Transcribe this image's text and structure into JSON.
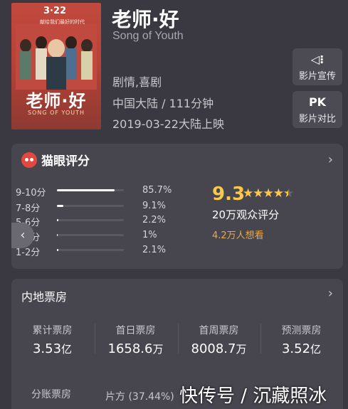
{
  "movie": {
    "title": "老师·好",
    "subtitle": "Song of Youth",
    "genre": "剧情,喜剧",
    "region_duration": "中国大陆 / 111分钟",
    "release": "2019-03-22大陆上映"
  },
  "poster": {
    "date_text": "3·22",
    "tag_text": "献给我们最好的时代",
    "title_text": "老师·好",
    "sub_text": "SONG OF YOUTH"
  },
  "side_buttons": [
    {
      "label": "影片宣传",
      "icon": "speaker-icon",
      "icon_text": "◁⁝"
    },
    {
      "label": "影片对比",
      "icon": "pk-icon",
      "icon_text": "PK"
    }
  ],
  "rating": {
    "source": "猫眼评分",
    "score": "9.3",
    "stars": 4.5,
    "audience_text": "20万观众评分",
    "want_text": "4.2万人想看",
    "distribution": [
      {
        "label": "9-10分",
        "pct": "85.7%",
        "value": 85.7
      },
      {
        "label": "7-8分",
        "pct": "9.1%",
        "value": 9.1
      },
      {
        "label": "5-6分",
        "pct": "2.2%",
        "value": 2.2
      },
      {
        "label": "3-4分",
        "pct": "1%",
        "value": 1.0
      },
      {
        "label": "1-2分",
        "pct": "2.1%",
        "value": 2.1
      }
    ]
  },
  "box_office": {
    "title": "内地票房",
    "items": [
      {
        "label": "累计票房",
        "value": "3.53",
        "unit": "亿"
      },
      {
        "label": "首日票房",
        "value": "1658.6",
        "unit": "万"
      },
      {
        "label": "首周票房",
        "value": "8008.7",
        "unit": "万"
      },
      {
        "label": "预测票房",
        "value": "3.52",
        "unit": "亿"
      }
    ],
    "share_label": "分账票房",
    "share_producer": "片方 (37.44%)"
  },
  "watermark": "快传号 / 沉藏照冰",
  "colors": {
    "accent_gold": "#fcc84a",
    "want_orange": "#e8a94a",
    "maoyan_red": "#e2483d"
  }
}
